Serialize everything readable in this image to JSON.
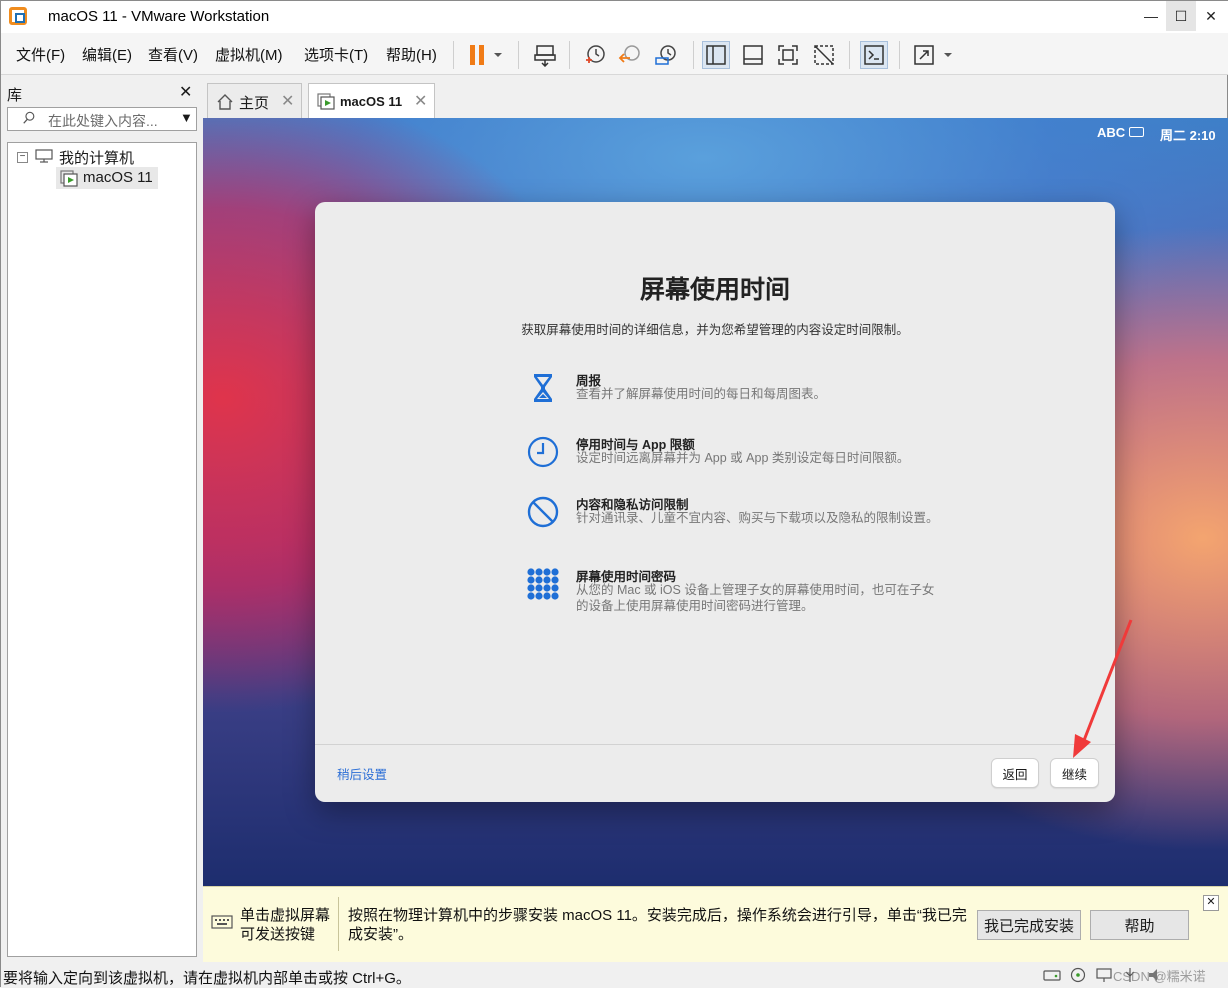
{
  "window": {
    "title": "macOS 11 - VMware Workstation",
    "controls": {
      "minimize": "—",
      "maximize": "☐",
      "close": "✕"
    }
  },
  "menu": [
    {
      "label": "文件(F)"
    },
    {
      "label": "编辑(E)"
    },
    {
      "label": "查看(V)"
    },
    {
      "label": "虚拟机(M)"
    },
    {
      "label": "选项卡(T)"
    },
    {
      "label": "帮助(H)"
    }
  ],
  "toolbar": {
    "icons": [
      "pause-icon",
      "dropdown-arrow-icon",
      "send-ctrl-alt-del-icon",
      "snapshot-icon",
      "revert-snapshot-icon",
      "snapshot-manager-icon",
      "library-view-icon",
      "thumbnail-bar-icon",
      "fullscreen-icon",
      "unity-icon",
      "console-icon",
      "stretch-icon",
      "dropdown-arrow-icon"
    ],
    "accent_pause": "#f07b16"
  },
  "library": {
    "title": "库",
    "close": "✕",
    "search_placeholder": "在此处键入内容...",
    "search_arrow": "▼",
    "tree": {
      "expander": "−",
      "computer_label": "我的计算机",
      "vm_label": "macOS 11"
    }
  },
  "tabs": [
    {
      "label": "主页",
      "close": "✕",
      "icon": "home-icon"
    },
    {
      "label": "macOS 11",
      "close": "✕",
      "icon": "vm-running-icon"
    }
  ],
  "vm": {
    "status": {
      "input": "ABC",
      "clock": "周二 2:10"
    },
    "dialog": {
      "title": "屏幕使用时间",
      "subtitle": "获取屏幕使用时间的详细信息，并为您希望管理的内容设定时间限制。",
      "features": [
        {
          "icon": "hourglass-icon",
          "title": "周报",
          "desc": "查看并了解屏幕使用时间的每日和每周图表。"
        },
        {
          "icon": "clock-icon",
          "title": "停用时间与 App 限额",
          "desc": "设定时间远离屏幕并为 App 或 App 类别设定每日时间限额。"
        },
        {
          "icon": "restricted-icon",
          "title": "内容和隐私访问限制",
          "desc": "针对通讯录、儿童不宜内容、购买与下载项以及隐私的限制设置。"
        },
        {
          "icon": "passcode-keypad-icon",
          "title": "屏幕使用时间密码",
          "desc": "从您的 Mac 或 iOS 设备上管理子女的屏幕使用时间，也可在子女的设备上使用屏幕使用时间密码进行管理。"
        }
      ],
      "later_link": "稍后设置",
      "back_button": "返回",
      "continue_button": "继续"
    },
    "accent_blue": "#1f6fd6",
    "annotation_arrow_color": "#f03a3a"
  },
  "hintbar": {
    "left_text": "单击虚拟屏幕可发送按键",
    "left_line1": "单击虚拟屏幕",
    "left_line2": "可发送按键",
    "message": "按照在物理计算机中的步骤安装 macOS 11。安装完成后，操作系统会进行引导，单击“我已完成安装”。",
    "done_button": "我已完成安装",
    "help_button": "帮助",
    "close": "✕"
  },
  "statusbar": {
    "text": "要将输入定向到该虚拟机，请在虚拟机内部单击或按 Ctrl+G。",
    "icons": [
      "hard-disk-icon",
      "cd-rom-icon",
      "network-icon",
      "usb-icon",
      "sound-icon"
    ],
    "watermark": "CSDN @糯米诺"
  }
}
